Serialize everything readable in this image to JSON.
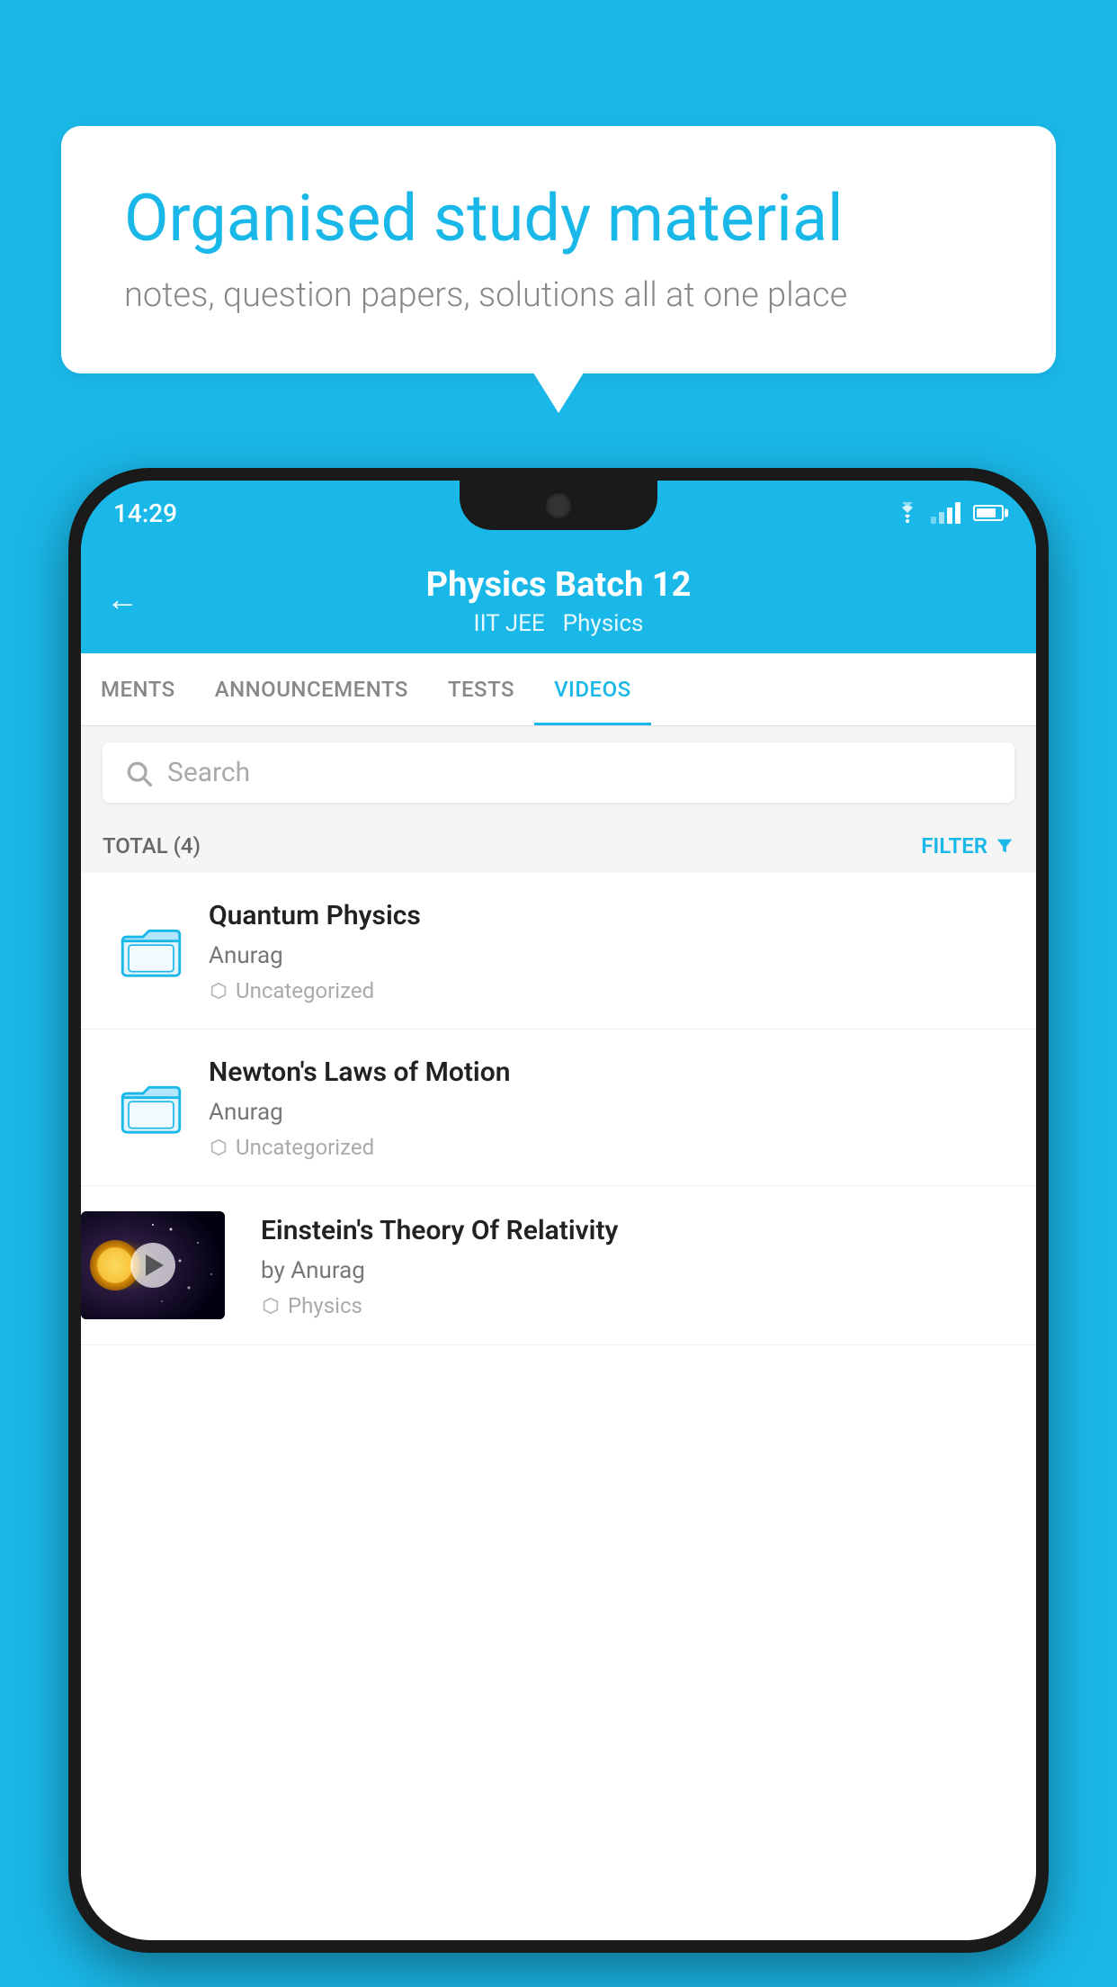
{
  "background": {
    "color": "#1ab8e8"
  },
  "speech_bubble": {
    "heading": "Organised study material",
    "subtext": "notes, question papers, solutions all at one place"
  },
  "status_bar": {
    "time": "14:29"
  },
  "app": {
    "header": {
      "title": "Physics Batch 12",
      "subtitle1": "IIT JEE",
      "subtitle2": "Physics"
    },
    "tabs": [
      {
        "label": "MENTS",
        "active": false
      },
      {
        "label": "ANNOUNCEMENTS",
        "active": false
      },
      {
        "label": "TESTS",
        "active": false
      },
      {
        "label": "VIDEOS",
        "active": true
      }
    ],
    "search": {
      "placeholder": "Search"
    },
    "filter": {
      "total_label": "TOTAL (4)",
      "filter_label": "FILTER"
    },
    "videos": [
      {
        "title": "Quantum Physics",
        "author": "Anurag",
        "tag": "Uncategorized",
        "type": "folder",
        "has_thumb": false
      },
      {
        "title": "Newton's Laws of Motion",
        "author": "Anurag",
        "tag": "Uncategorized",
        "type": "folder",
        "has_thumb": false
      },
      {
        "title": "Einstein's Theory Of Relativity",
        "author": "by Anurag",
        "tag": "Physics",
        "type": "video",
        "has_thumb": true
      }
    ]
  }
}
